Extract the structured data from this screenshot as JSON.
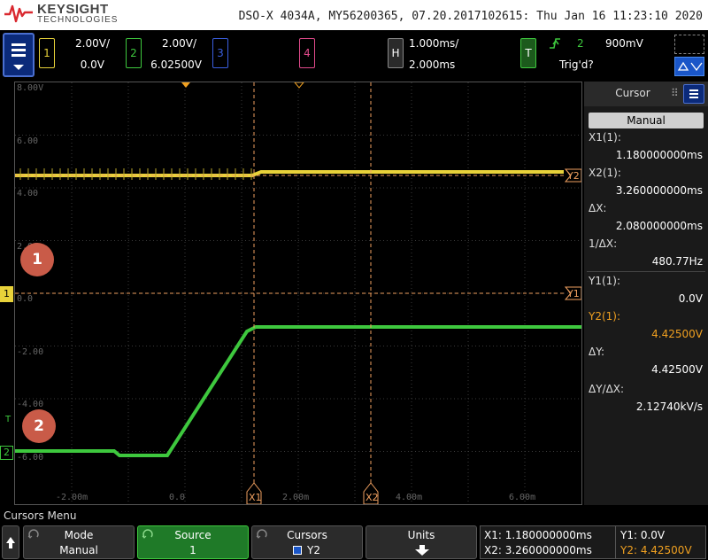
{
  "header": {
    "brand": "KEYSIGHT",
    "brand_sub": "TECHNOLOGIES",
    "title": "DSO-X 4034A, MY56200365, 07.20.2017102615: Thu Jan 16 11:23:10 2020"
  },
  "channels": {
    "ch1": {
      "label": "1",
      "scale": "2.00V/",
      "offset": "0.0V",
      "color": "#e8d23a"
    },
    "ch2": {
      "label": "2",
      "scale": "2.00V/",
      "offset": "6.02500V",
      "color": "#3ec83e"
    },
    "ch3": {
      "label": "3",
      "color": "#3a5fe0"
    },
    "ch4": {
      "label": "4",
      "color": "#e04a8a"
    }
  },
  "horizontal": {
    "label": "H",
    "scale": "1.000ms/",
    "delay": "2.000ms"
  },
  "trigger": {
    "label": "T",
    "source": "2",
    "level": "900mV",
    "status": "Trig'd?",
    "slope_icon": "rising-edge-icon"
  },
  "display": {
    "y_ticks": [
      "8.00V",
      "6.00",
      "4.00",
      "2.00",
      "0.0",
      "-2.00",
      "-4.00",
      "-6.00"
    ],
    "x_ticks": [
      "-2.00m",
      "0.0",
      "2.00m",
      "4.00m",
      "6.00m"
    ],
    "cursor_labels": {
      "x1": "X1",
      "x2": "X2",
      "y1": "Y1",
      "y2": "Y2"
    },
    "ch1_marker": "1",
    "ch2_marker": "2",
    "trigger_marker": "T",
    "badges": [
      "1",
      "2"
    ]
  },
  "cursor_panel": {
    "title": "Cursor",
    "mode_button": "Manual",
    "x1_label": "X1(1):",
    "x1_value": "1.180000000ms",
    "x2_label": "X2(1):",
    "x2_value": "3.260000000ms",
    "dx_label": "ΔX:",
    "dx_value": "2.080000000ms",
    "inv_dx_label": "1/ΔX:",
    "inv_dx_value": "480.77Hz",
    "y1_label": "Y1(1):",
    "y1_value": "0.0V",
    "y2_label": "Y2(1):",
    "y2_value": "4.42500V",
    "dy_label": "ΔY:",
    "dy_value": "4.42500V",
    "dydx_label": "ΔY/ΔX:",
    "dydx_value": "2.12740kV/s",
    "y2_color": "#f0a020"
  },
  "bottom": {
    "menu_title": "Cursors Menu",
    "mode": {
      "label": "Mode",
      "value": "Manual"
    },
    "source": {
      "label": "Source",
      "value": "1"
    },
    "cursors": {
      "label": "Cursors",
      "value": "Y2"
    },
    "units": {
      "label": "Units"
    },
    "readout": {
      "x1": "X1: 1.180000000ms",
      "x2": "X2: 3.260000000ms",
      "y1": "Y1: 0.0V",
      "y2": "Y2: 4.42500V"
    }
  }
}
